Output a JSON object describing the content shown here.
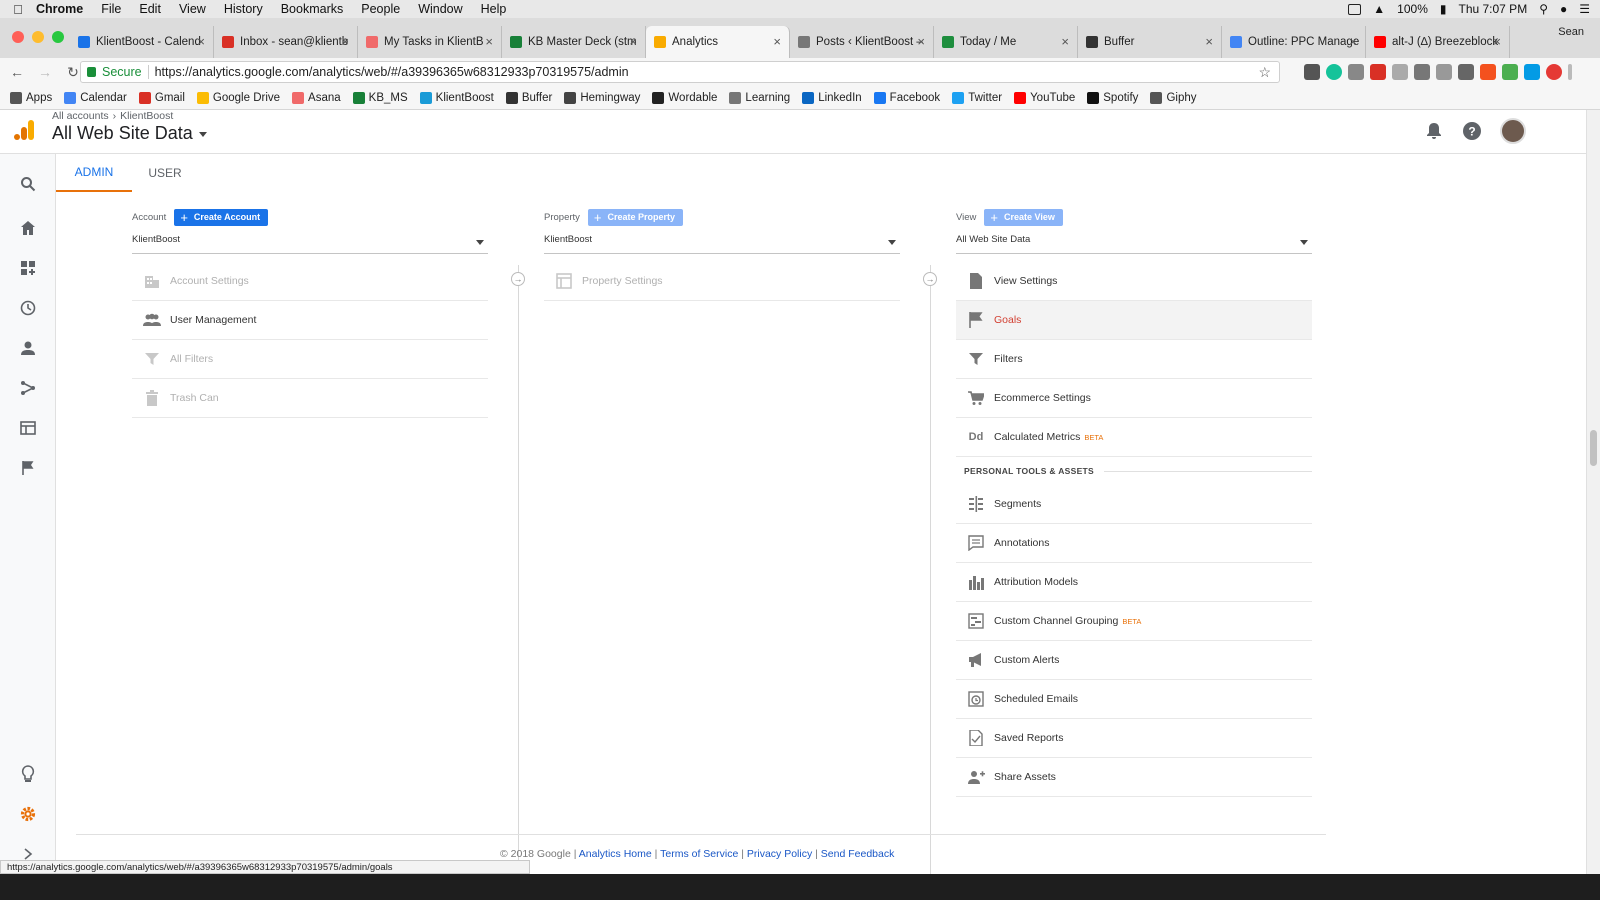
{
  "mac_menu": {
    "app": "Chrome",
    "items": [
      "File",
      "Edit",
      "View",
      "History",
      "Bookmarks",
      "People",
      "Window",
      "Help"
    ],
    "battery": "100%",
    "clock": "Thu 7:07 PM"
  },
  "tabs": [
    {
      "title": "KlientBoost - Calend",
      "color": "#1a73e8"
    },
    {
      "title": "Inbox - sean@klientb",
      "color": "#d93025"
    },
    {
      "title": "My Tasks in KlientB",
      "color": "#f06a6a"
    },
    {
      "title": "KB Master Deck (stm",
      "color": "#188038"
    },
    {
      "title": "Analytics",
      "color": "#f9ab00",
      "active": true
    },
    {
      "title": "Posts ‹ KlientBoost –",
      "color": "#777777"
    },
    {
      "title": "Today / Me",
      "color": "#1e8e3e"
    },
    {
      "title": "Buffer",
      "color": "#333333"
    },
    {
      "title": "Outline: PPC Manage",
      "color": "#4285f4"
    },
    {
      "title": "alt-J (∆) Breezeblock",
      "color": "#ff0000"
    }
  ],
  "profile_name": "Sean",
  "address": {
    "secure_label": "Secure",
    "url": "https://analytics.google.com/analytics/web/#/a39396365w68312933p70319575/admin"
  },
  "bookmarks": [
    {
      "label": "Apps",
      "color": "#555555"
    },
    {
      "label": "Calendar",
      "color": "#4285f4"
    },
    {
      "label": "Gmail",
      "color": "#d93025"
    },
    {
      "label": "Google Drive",
      "color": "#fbbc04"
    },
    {
      "label": "Asana",
      "color": "#f06a6a"
    },
    {
      "label": "KB_MS",
      "color": "#188038"
    },
    {
      "label": "KlientBoost",
      "color": "#1a9bd7"
    },
    {
      "label": "Buffer",
      "color": "#333333"
    },
    {
      "label": "Hemingway",
      "color": "#444444"
    },
    {
      "label": "Wordable",
      "color": "#222222"
    },
    {
      "label": "Learning",
      "color": "#777777"
    },
    {
      "label": "LinkedIn",
      "color": "#0a66c2"
    },
    {
      "label": "Facebook",
      "color": "#1877f2"
    },
    {
      "label": "Twitter",
      "color": "#1da1f2"
    },
    {
      "label": "YouTube",
      "color": "#ff0000"
    },
    {
      "label": "Spotify",
      "color": "#111111"
    },
    {
      "label": "Giphy",
      "color": "#555555"
    }
  ],
  "ga": {
    "breadcrumb": {
      "root": "All accounts",
      "account": "KlientBoost"
    },
    "view_title": "All Web Site Data",
    "subtabs": {
      "admin": "ADMIN",
      "user": "USER"
    },
    "account_col": {
      "label": "Account",
      "create": "Create Account",
      "selected": "KlientBoost",
      "items": [
        "Account Settings",
        "User Management",
        "All Filters",
        "Trash Can"
      ]
    },
    "property_col": {
      "label": "Property",
      "create": "Create Property",
      "selected": "KlientBoost",
      "items": [
        "Property Settings"
      ]
    },
    "view_col": {
      "label": "View",
      "create": "Create View",
      "selected": "All Web Site Data",
      "items": [
        "View Settings",
        "Goals",
        "Filters",
        "Ecommerce Settings",
        "Calculated Metrics"
      ],
      "section": "PERSONAL TOOLS & ASSETS",
      "tools": [
        "Segments",
        "Annotations",
        "Attribution Models",
        "Custom Channel Grouping",
        "Custom Alerts",
        "Scheduled Emails",
        "Saved Reports",
        "Share Assets"
      ],
      "beta": "BETA"
    },
    "footer": {
      "copyright": "© 2018 Google",
      "links": [
        "Analytics Home",
        "Terms of Service",
        "Privacy Policy",
        "Send Feedback"
      ]
    }
  },
  "status_url": "https://analytics.google.com/analytics/web/#/a39396365w68312933p70319575/admin/goals"
}
